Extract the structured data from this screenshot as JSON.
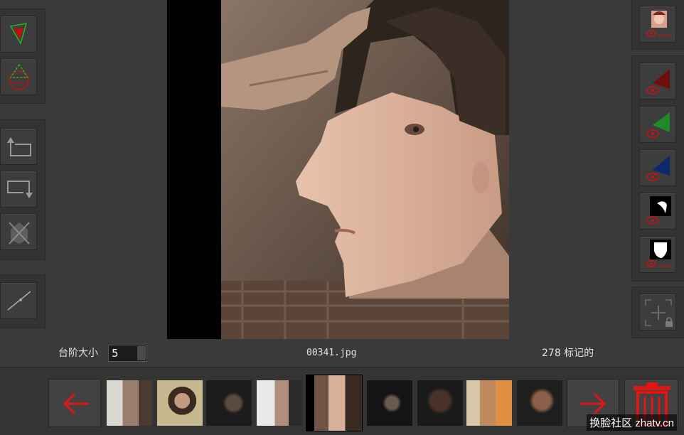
{
  "left_toolbar": {
    "groups": [
      {
        "tools": [
          "select-triangle-tool",
          "select-face-mesh-tool"
        ]
      },
      {
        "tools": [
          "undo-tool",
          "redo-tool",
          "clear-tool"
        ]
      },
      {
        "tools": [
          "line-tool"
        ]
      }
    ]
  },
  "right_toolbar": {
    "layers": [
      {
        "name": "face-preview-layer",
        "badge": "10img"
      },
      {
        "name": "red-layer",
        "color": "#7a0f0f"
      },
      {
        "name": "green-layer",
        "color": "#1e8a2a"
      },
      {
        "name": "blue-layer",
        "color": "#0b2a6e"
      },
      {
        "name": "eyebrow-mask-layer"
      },
      {
        "name": "face-mask-layer",
        "badge": "10img"
      }
    ],
    "locked_add_label": "add-point-locked"
  },
  "step_size": {
    "label": "台阶大小",
    "value": "5"
  },
  "file_name": "00341.jpg",
  "marked_count": "278 标记的",
  "watermark": "换脸社区 zhatv.cn",
  "colors": {
    "accent_red": "#e01515",
    "bg": "#3a3a3a"
  }
}
